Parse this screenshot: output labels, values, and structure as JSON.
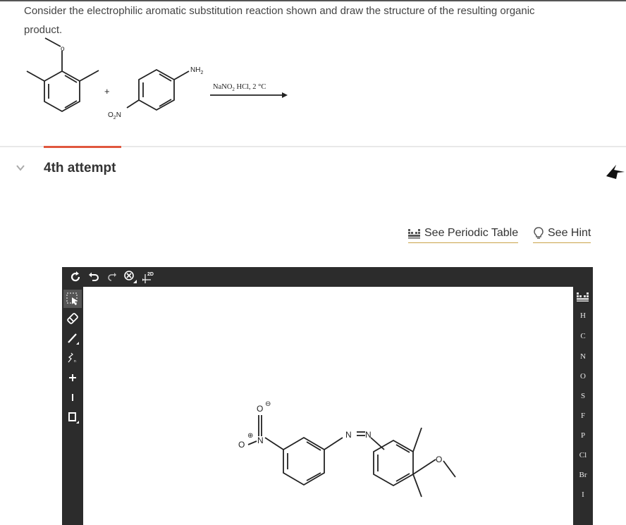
{
  "question": {
    "line1": "Consider the electrophilic aromatic substitution reaction shown and draw the structure of the resulting organic",
    "line2": "product."
  },
  "reaction": {
    "plus": "+",
    "amine_label": "NH",
    "amine_sub": "2",
    "nitro_label_o": "O",
    "nitro_sub": "2",
    "nitro_label_n": "N",
    "ether_o": "o",
    "reagent_a": "NaNO",
    "reagent_sub": "2",
    "reagent_b": " HCl, 2 °C"
  },
  "attempt": {
    "title": "4th attempt"
  },
  "links": {
    "periodic_table": "See Periodic Table",
    "hint": "See Hint"
  },
  "editor": {
    "top_toolbar": [
      "refresh-icon",
      "undo-icon",
      "redo-icon",
      "zoom-icon",
      "2d-cleanup-icon"
    ],
    "top_toolbar_2d": "2D",
    "left_toolbar": [
      "select-icon",
      "erase-icon",
      "bond-icon",
      "chain-icon",
      "charge-plus-icon",
      "charge-minus-icon",
      "template-icon"
    ],
    "elements": [
      "H",
      "C",
      "N",
      "O",
      "S",
      "F",
      "P",
      "Cl",
      "Br",
      "I"
    ],
    "structure": {
      "nitro_o_top": "O",
      "nitro_minus": "⊖",
      "nitro_n": "N",
      "nitro_plus": "⊕",
      "nitro_o_left": "O",
      "azo_n1": "N",
      "azo_n2": "N",
      "ether_o": "O"
    }
  },
  "colors": {
    "accent": "#e0573e",
    "link_underline": "#c9a44a",
    "toolbar": "#2c2c2c"
  }
}
